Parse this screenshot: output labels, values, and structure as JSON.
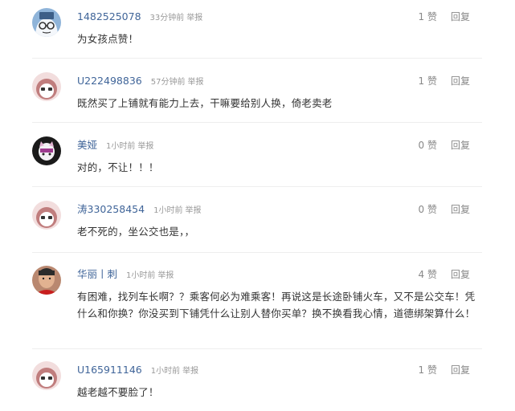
{
  "comments": [
    {
      "username": "1482525078",
      "time": "33分钟前",
      "report_label": "举报",
      "likes": "1 赞",
      "reply_label": "回复",
      "content": "为女孩点赞！",
      "avatar": "default-robot-avatar"
    },
    {
      "username": "U222498836",
      "time": "57分钟前",
      "report_label": "举报",
      "likes": "1 赞",
      "reply_label": "回复",
      "content": "既然买了上铺就有能力上去，干嘛要给别人换，倚老卖老",
      "avatar": "default-pink-avatar"
    },
    {
      "username": "美娅",
      "time": "1小时前",
      "report_label": "举报",
      "likes": "0 赞",
      "reply_label": "回复",
      "content": "对的，不让！！！",
      "avatar": "cartoon-avatar"
    },
    {
      "username": "涛330258454",
      "time": "1小时前",
      "report_label": "举报",
      "likes": "0 赞",
      "reply_label": "回复",
      "content": "老不死的，坐公交也是，，",
      "avatar": "default-pink-avatar"
    },
    {
      "username": "华丽丨刺",
      "time": "1小时前",
      "report_label": "举报",
      "likes": "4 赞",
      "reply_label": "回复",
      "content": "有困难，找列车长啊？？乘客何必为难乘客！再说这是长途卧铺火车，又不是公交车！凭什么和你换？你没买到下铺凭什么让别人替你买单？换不换看我心情，道德绑架算什么！",
      "avatar": "photo-avatar"
    },
    {
      "username": "U165911146",
      "time": "1小时前",
      "report_label": "举报",
      "likes": "1 赞",
      "reply_label": "回复",
      "content": "越老越不要脸了！",
      "avatar": "default-pink-avatar"
    }
  ]
}
